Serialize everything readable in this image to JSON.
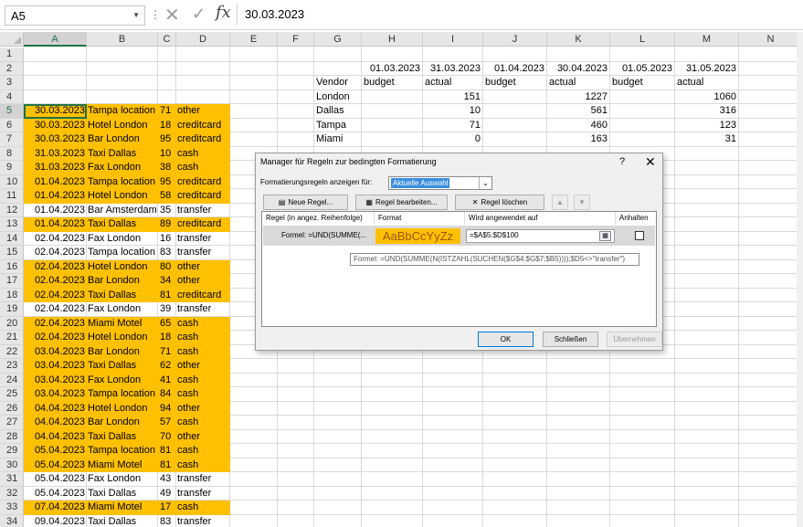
{
  "formula_bar": {
    "name_box": "A5",
    "content": "30.03.2023"
  },
  "columns": [
    "A",
    "B",
    "C",
    "D",
    "E",
    "F",
    "G",
    "H",
    "I",
    "J",
    "K",
    "L",
    "M",
    "N"
  ],
  "selected_column": "A",
  "selected_row": "5",
  "rows": [
    {
      "n": "1",
      "a": "",
      "b": "",
      "c": "",
      "d": "",
      "hl": false
    },
    {
      "n": "2",
      "a": "",
      "b": "",
      "c": "",
      "d": "",
      "hl": false
    },
    {
      "n": "3",
      "a": "",
      "b": "",
      "c": "",
      "d": "",
      "hl": false
    },
    {
      "n": "4",
      "a": "",
      "b": "",
      "c": "",
      "d": "",
      "hl": false
    },
    {
      "n": "5",
      "a": "30.03.2023",
      "b": "Tampa location",
      "c": "71",
      "d": "other",
      "hl": true
    },
    {
      "n": "6",
      "a": "30.03.2023",
      "b": "Hotel London",
      "c": "18",
      "d": "creditcard",
      "hl": true
    },
    {
      "n": "7",
      "a": "30.03.2023",
      "b": "Bar London",
      "c": "95",
      "d": "creditcard",
      "hl": true
    },
    {
      "n": "8",
      "a": "31.03.2023",
      "b": "Taxi Dallas",
      "c": "10",
      "d": "cash",
      "hl": true
    },
    {
      "n": "9",
      "a": "31.03.2023",
      "b": "Fax London",
      "c": "38",
      "d": "cash",
      "hl": true
    },
    {
      "n": "10",
      "a": "01.04.2023",
      "b": "Tampa location",
      "c": "95",
      "d": "creditcard",
      "hl": true
    },
    {
      "n": "11",
      "a": "01.04.2023",
      "b": "Hotel London",
      "c": "58",
      "d": "creditcard",
      "hl": true
    },
    {
      "n": "12",
      "a": "01.04.2023",
      "b": "Bar Amsterdam",
      "c": "35",
      "d": "transfer",
      "hl": false
    },
    {
      "n": "13",
      "a": "01.04.2023",
      "b": "Taxi Dallas",
      "c": "89",
      "d": "creditcard",
      "hl": true
    },
    {
      "n": "14",
      "a": "02.04.2023",
      "b": "Fax London",
      "c": "16",
      "d": "transfer",
      "hl": false
    },
    {
      "n": "15",
      "a": "02.04.2023",
      "b": "Tampa location",
      "c": "83",
      "d": "transfer",
      "hl": false
    },
    {
      "n": "16",
      "a": "02.04.2023",
      "b": "Hotel London",
      "c": "80",
      "d": "other",
      "hl": true
    },
    {
      "n": "17",
      "a": "02.04.2023",
      "b": "Bar London",
      "c": "34",
      "d": "other",
      "hl": true
    },
    {
      "n": "18",
      "a": "02.04.2023",
      "b": "Taxi Dallas",
      "c": "81",
      "d": "creditcard",
      "hl": true
    },
    {
      "n": "19",
      "a": "02.04.2023",
      "b": "Fax London",
      "c": "39",
      "d": "transfer",
      "hl": false
    },
    {
      "n": "20",
      "a": "02.04.2023",
      "b": "Miami Motel",
      "c": "65",
      "d": "cash",
      "hl": true
    },
    {
      "n": "21",
      "a": "02.04.2023",
      "b": "Hotel London",
      "c": "18",
      "d": "cash",
      "hl": true
    },
    {
      "n": "22",
      "a": "03.04.2023",
      "b": "Bar London",
      "c": "71",
      "d": "cash",
      "hl": true
    },
    {
      "n": "23",
      "a": "03.04.2023",
      "b": "Taxi Dallas",
      "c": "62",
      "d": "other",
      "hl": true
    },
    {
      "n": "24",
      "a": "03.04.2023",
      "b": "Fax London",
      "c": "41",
      "d": "cash",
      "hl": true
    },
    {
      "n": "25",
      "a": "03.04.2023",
      "b": "Tampa location",
      "c": "84",
      "d": "cash",
      "hl": true
    },
    {
      "n": "26",
      "a": "04.04.2023",
      "b": "Hotel London",
      "c": "94",
      "d": "other",
      "hl": true
    },
    {
      "n": "27",
      "a": "04.04.2023",
      "b": "Bar London",
      "c": "57",
      "d": "cash",
      "hl": true
    },
    {
      "n": "28",
      "a": "04.04.2023",
      "b": "Taxi Dallas",
      "c": "70",
      "d": "other",
      "hl": true
    },
    {
      "n": "29",
      "a": "05.04.2023",
      "b": "Tampa location",
      "c": "81",
      "d": "cash",
      "hl": true
    },
    {
      "n": "30",
      "a": "05.04.2023",
      "b": "Miami Motel",
      "c": "81",
      "d": "cash",
      "hl": true
    },
    {
      "n": "31",
      "a": "05.04.2023",
      "b": "Fax London",
      "c": "43",
      "d": "transfer",
      "hl": false
    },
    {
      "n": "32",
      "a": "05.04.2023",
      "b": "Taxi Dallas",
      "c": "49",
      "d": "transfer",
      "hl": false
    },
    {
      "n": "33",
      "a": "07.04.2023",
      "b": "Miami Motel",
      "c": "17",
      "d": "cash",
      "hl": true
    },
    {
      "n": "34",
      "a": "09.04.2023",
      "b": "Taxi Dallas",
      "c": "83",
      "d": "transfer",
      "hl": false
    }
  ],
  "summary": {
    "dates": [
      "01.03.2023",
      "31.03.2023",
      "01.04.2023",
      "30.04.2023",
      "01.05.2023",
      "31.05.2023"
    ],
    "vendor_label": "Vendor",
    "types": [
      "budget",
      "actual",
      "budget",
      "actual",
      "budget",
      "actual"
    ],
    "vendors": [
      {
        "name": "London",
        "i": "151",
        "k": "1227",
        "m": "1060"
      },
      {
        "name": "Dallas",
        "i": "10",
        "k": "561",
        "m": "316"
      },
      {
        "name": "Tampa",
        "i": "71",
        "k": "460",
        "m": "123"
      },
      {
        "name": "Miami",
        "i": "0",
        "k": "163",
        "m": "31"
      }
    ]
  },
  "dialog": {
    "title": "Manager für Regeln zur bedingten Formatierung",
    "help": "?",
    "close": "✕",
    "show_label": "Formatierungsregeln anzeigen für:",
    "show_value": "Aktuelle Auswahl",
    "btn_new": "Neue Regel...",
    "btn_edit": "Regel bearbeiten...",
    "btn_delete": "Regel löschen",
    "col_rule": "Regel (in angez. Reihenfolge)",
    "col_format": "Format",
    "col_applies": "Wird angewendet auf",
    "col_stop": "Anhalten",
    "rule_label": "Formel: =UND(SUMME(...",
    "format_preview": "AaBbCcYyZz",
    "applies_to": "=$A$5:$D$100",
    "tooltip": "Formel: =UND(SUMME(N(ISTZAHL(SUCHEN($G$4:$G$7;$B5))));$D5<>\"transfer\")",
    "btn_ok": "OK",
    "btn_close": "Schließen",
    "btn_apply": "Übernehmen"
  },
  "colors": {
    "highlight": "#ffc000",
    "selection": "#217346",
    "format_text": "#9c5700"
  }
}
